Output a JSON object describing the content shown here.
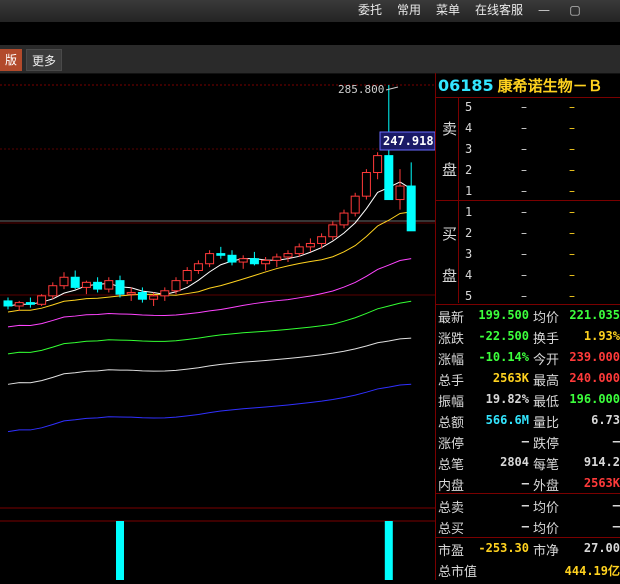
{
  "menu": {
    "items": [
      "委托",
      "常用",
      "菜单",
      "在线客服"
    ],
    "minimize": "—",
    "restore": "▢"
  },
  "tabs": {
    "active": "版",
    "more": "更多"
  },
  "chart": {
    "high_label": "285.800",
    "price_tag": "247.918",
    "up_color": "#ff3a3a",
    "down_color": "#00ffff"
  },
  "chart_data": {
    "type": "candlestick",
    "ohlc": [
      [
        158,
        160,
        153,
        155
      ],
      [
        155,
        158,
        152,
        157
      ],
      [
        157,
        160,
        154,
        156
      ],
      [
        156,
        162,
        155,
        161
      ],
      [
        161,
        169,
        159,
        167
      ],
      [
        167,
        175,
        165,
        172
      ],
      [
        172,
        176,
        165,
        166
      ],
      [
        166,
        170,
        162,
        169
      ],
      [
        169,
        172,
        163,
        165
      ],
      [
        165,
        172,
        163,
        170
      ],
      [
        170,
        173,
        160,
        162
      ],
      [
        162,
        166,
        158,
        163
      ],
      [
        163,
        166,
        157,
        159
      ],
      [
        159,
        163,
        155,
        161
      ],
      [
        161,
        166,
        158,
        164
      ],
      [
        164,
        172,
        162,
        170
      ],
      [
        170,
        178,
        168,
        176
      ],
      [
        176,
        182,
        174,
        180
      ],
      [
        180,
        188,
        178,
        186
      ],
      [
        186,
        190,
        183,
        185
      ],
      [
        185,
        188,
        179,
        181
      ],
      [
        181,
        185,
        177,
        183
      ],
      [
        183,
        187,
        179,
        180
      ],
      [
        180,
        184,
        176,
        182
      ],
      [
        182,
        186,
        178,
        184
      ],
      [
        184,
        188,
        181,
        186
      ],
      [
        186,
        192,
        184,
        190
      ],
      [
        190,
        195,
        187,
        192
      ],
      [
        192,
        198,
        189,
        196
      ],
      [
        196,
        205,
        194,
        203
      ],
      [
        203,
        212,
        201,
        210
      ],
      [
        210,
        222,
        208,
        220
      ],
      [
        220,
        236,
        218,
        234
      ],
      [
        234,
        246,
        230,
        244
      ],
      [
        244,
        285.8,
        238,
        218
      ],
      [
        218,
        236,
        212,
        226
      ],
      [
        226,
        240,
        200,
        199.5
      ]
    ],
    "volume": [
      {
        "index": 10,
        "value": 1
      },
      {
        "index": 34,
        "value": 1
      }
    ]
  },
  "quote": {
    "code": "06185",
    "name": "康希诺生物－Ｂ",
    "sell_label": [
      "卖",
      "盘"
    ],
    "buy_label": [
      "买",
      "盘"
    ],
    "sell_levels": [
      "5",
      "4",
      "3",
      "2",
      "1"
    ],
    "buy_levels": [
      "1",
      "2",
      "3",
      "4",
      "5"
    ],
    "dash": "–",
    "rows": [
      {
        "l1": "最新",
        "v1": "199.500",
        "c1": "#3cff3c",
        "l2": "均价",
        "v2": "221.035",
        "c2": "#3cff3c"
      },
      {
        "l1": "涨跌",
        "v1": "-22.500",
        "c1": "#3cff3c",
        "l2": "换手",
        "v2": "1.93%",
        "c2": "#ffd21f"
      },
      {
        "l1": "涨幅",
        "v1": "-10.14%",
        "c1": "#3cff3c",
        "l2": "今开",
        "v2": "239.000",
        "c2": "#ff3a3a"
      },
      {
        "l1": "总手",
        "v1": "2563K",
        "c1": "#ffd21f",
        "l2": "最高",
        "v2": "240.000",
        "c2": "#ff3a3a"
      },
      {
        "l1": "振幅",
        "v1": "19.82%",
        "c1": "#d8d8d8",
        "l2": "最低",
        "v2": "196.000",
        "c2": "#3cff3c"
      },
      {
        "l1": "总额",
        "v1": "566.6M",
        "c1": "#33e6ff",
        "l2": "量比",
        "v2": "6.73",
        "c2": "#d8d8d8"
      },
      {
        "l1": "涨停",
        "v1": "–",
        "c1": "#d8d8d8",
        "l2": "跌停",
        "v2": "–",
        "c2": "#d8d8d8"
      },
      {
        "l1": "总笔",
        "v1": "2804",
        "c1": "#d8d8d8",
        "l2": "每笔",
        "v2": "914.2",
        "c2": "#d8d8d8"
      },
      {
        "l1": "内盘",
        "v1": "–",
        "c1": "#d8d8d8",
        "l2": "外盘",
        "v2": "2563K",
        "c2": "#ff3a3a"
      }
    ],
    "total_sell": {
      "l1": "总卖",
      "v1": "–",
      "l2": "均价",
      "v2": "–"
    },
    "total_buy": {
      "l1": "总买",
      "v1": "–",
      "l2": "均价",
      "v2": "–"
    },
    "pe": {
      "l1": "市盈",
      "v1": "-253.30",
      "l2": "市净",
      "v2": "27.00"
    },
    "mcap": {
      "l1": "总市值",
      "v1": "444.19亿"
    }
  }
}
